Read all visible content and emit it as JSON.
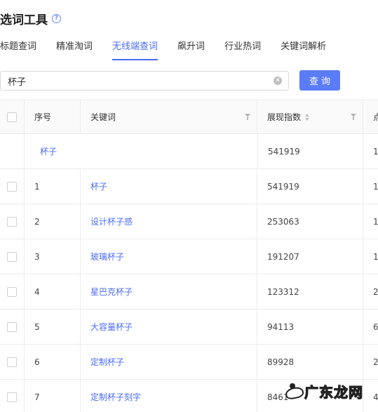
{
  "header": {
    "title": "选词工具"
  },
  "tabs": [
    {
      "label": "标题查词",
      "active": false
    },
    {
      "label": "精准淘词",
      "active": false
    },
    {
      "label": "无线端查词",
      "active": true
    },
    {
      "label": "飙升词",
      "active": false
    },
    {
      "label": "行业热词",
      "active": false
    },
    {
      "label": "关键词解析",
      "active": false
    }
  ],
  "search": {
    "value": "杯子",
    "button_label": "查询"
  },
  "table": {
    "columns": {
      "index": "序号",
      "keyword": "关键词",
      "display_index": "展现指数",
      "extra": "点"
    },
    "summary": {
      "keyword": "杯子",
      "display_index": "541919",
      "extra": "1"
    },
    "rows": [
      {
        "index": "1",
        "keyword": "杯子",
        "display_index": "541919",
        "extra": "1"
      },
      {
        "index": "2",
        "keyword": "设计杯子感",
        "display_index": "253063",
        "extra": "1"
      },
      {
        "index": "3",
        "keyword": "玻璃杯子",
        "display_index": "191207",
        "extra": "1"
      },
      {
        "index": "4",
        "keyword": "星巴克杯子",
        "display_index": "123312",
        "extra": "2"
      },
      {
        "index": "5",
        "keyword": "大容量杯子",
        "display_index": "94113",
        "extra": "6"
      },
      {
        "index": "6",
        "keyword": "定制杯子",
        "display_index": "89928",
        "extra": "2"
      },
      {
        "index": "7",
        "keyword": "定制杯子刻字",
        "display_index": "8461",
        "extra": "4"
      }
    ]
  },
  "watermark": {
    "text": "广东龙网"
  },
  "colors": {
    "accent": "#4a6cf7",
    "button": "#5a7cf7"
  }
}
